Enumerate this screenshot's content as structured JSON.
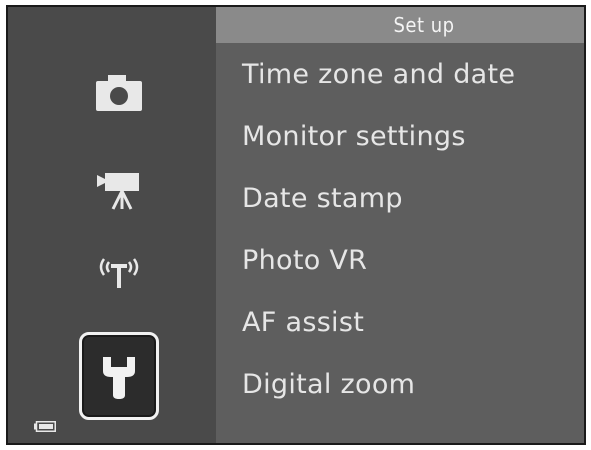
{
  "header": {
    "title": "Set up"
  },
  "sidebar": {
    "items": [
      {
        "icon": "camera-icon",
        "selected": false
      },
      {
        "icon": "movie-camera-icon",
        "selected": false
      },
      {
        "icon": "wireless-icon",
        "selected": false
      },
      {
        "icon": "wrench-icon",
        "selected": true
      }
    ],
    "battery_icon": "battery-icon"
  },
  "menu": {
    "items": [
      {
        "label": "Time zone and date"
      },
      {
        "label": "Monitor settings"
      },
      {
        "label": "Date stamp"
      },
      {
        "label": "Photo VR"
      },
      {
        "label": "AF assist"
      },
      {
        "label": "Digital zoom"
      }
    ]
  },
  "colors": {
    "sidebar_bg": "#4a4a4a",
    "main_bg": "#5e5e5e",
    "header_bg": "#8a8a8a",
    "text": "#e6e6e6",
    "selection_border": "#f2f2f2"
  }
}
